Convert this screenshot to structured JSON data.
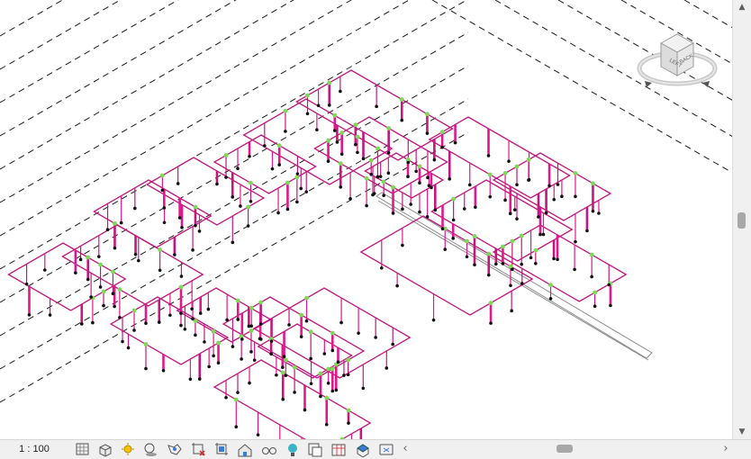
{
  "view": {
    "scale_label": "1 : 100",
    "view_cube": {
      "faces": [
        "BACK",
        "RIGHT",
        "LEFT"
      ],
      "front_face_label": "LEFT",
      "right_face_label": "BACK"
    },
    "colors": {
      "pipe": "#c2187e",
      "riser": "#e0188a",
      "fitting": "#7ed957",
      "terminal": "#111111",
      "reference_line": "#1a1a1a",
      "duct_outline": "#8c8c8c"
    }
  },
  "view_control_bar": {
    "tools": [
      {
        "name": "detail-level-icon"
      },
      {
        "name": "visual-style-icon"
      },
      {
        "name": "sun-path-icon"
      },
      {
        "name": "shadows-icon"
      },
      {
        "name": "render-dialog-icon"
      },
      {
        "name": "crop-view-icon"
      },
      {
        "name": "show-crop-region-icon"
      },
      {
        "name": "unlock-3d-view-icon"
      },
      {
        "name": "temporary-hide-isolate-icon"
      },
      {
        "name": "reveal-hidden-elements-icon"
      },
      {
        "name": "temporary-view-properties-icon"
      },
      {
        "name": "worksharing-display-icon"
      },
      {
        "name": "analytical-model-icon"
      },
      {
        "name": "highlight-displacement-icon"
      }
    ]
  },
  "scrollbars": {
    "horizontal": {
      "left_arrow": "‹",
      "right_arrow": "›"
    },
    "vertical": {
      "up_arrow": "▲",
      "down_arrow": "▼"
    }
  }
}
